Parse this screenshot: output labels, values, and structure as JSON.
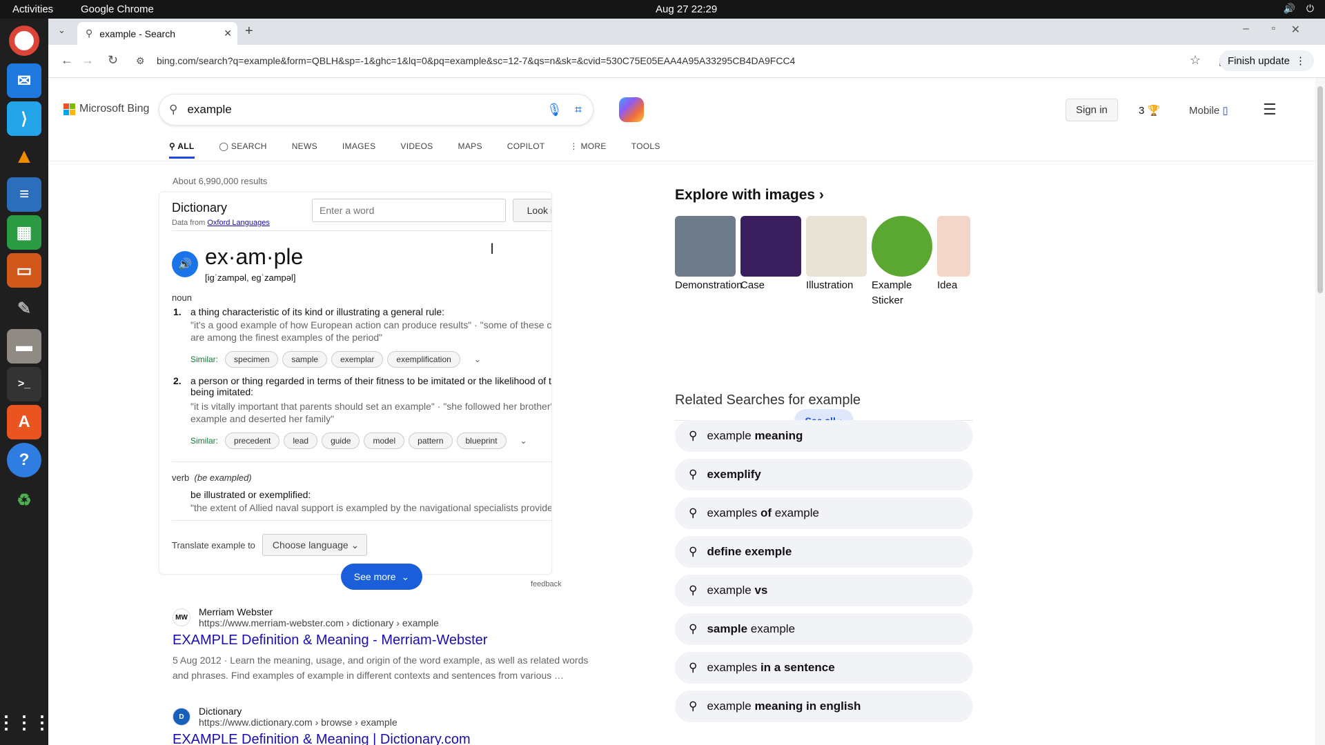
{
  "os": {
    "activities": "Activities",
    "app": "Google Chrome",
    "clock": "Aug 27  22:29"
  },
  "browser": {
    "tab_title": "example - Search",
    "url": "bing.com/search?q=example&form=QBLH&sp=-1&ghc=1&lq=0&pq=example&sc=12-7&qs=n&sk=&cvid=530C75E05EAA4A95A33295CB4DA9FCC4",
    "finish_update": "Finish update"
  },
  "bing": {
    "logo": "Microsoft Bing",
    "query": "example",
    "signin": "Sign in",
    "rewards": "3",
    "mobile": "Mobile",
    "tabs": [
      "ALL",
      "SEARCH",
      "NEWS",
      "IMAGES",
      "VIDEOS",
      "MAPS",
      "COPILOT",
      "MORE",
      "TOOLS"
    ],
    "result_count": "About 6,990,000 results"
  },
  "dictionary": {
    "title": "Dictionary",
    "source_prefix": "Data from",
    "source": "Oxford Languages",
    "input_placeholder": "Enter a word",
    "lookup": "Look it up",
    "word": "ex·am·ple",
    "pron": "[iɡˈzampəl, eɡˈzampəl]",
    "noun": "noun",
    "def1_num": "1.",
    "def1": "a thing characteristic of its kind or illustrating a general rule:",
    "def1_ex": "\"it's a good example of how European action can produce results\" · \"some of these carpets are among the finest examples of the period\"",
    "similar_label": "Similar:",
    "sim1": [
      "specimen",
      "sample",
      "exemplar",
      "exemplification"
    ],
    "def2_num": "2.",
    "def2": "a person or thing regarded in terms of their fitness to be imitated or the likelihood of their being imitated:",
    "def2_ex": "\"it is vitally important that parents should set an example\" · \"she followed her brother's example and deserted her family\"",
    "sim2": [
      "precedent",
      "lead",
      "guide",
      "model",
      "pattern",
      "blueprint"
    ],
    "verb": "verb",
    "verb_note": "(be exampled)",
    "def3": "be illustrated or exemplified:",
    "def3_ex": "\"the extent of Allied naval support is exampled by the navigational specialists provided\"",
    "translate": "Translate example to",
    "choose_lang": "Choose language",
    "see_more": "See more",
    "feedback": "feedback"
  },
  "results": [
    {
      "name": "Merriam Webster",
      "url": "https://www.merriam-webster.com › dictionary › example",
      "title": "EXAMPLE Definition & Meaning - Merriam-Webster",
      "snippet": "5 Aug 2012 · Learn the meaning, usage, and origin of the word example, as well as related words and phrases. Find examples of example in different contexts and sentences from various …"
    },
    {
      "name": "Dictionary",
      "url": "https://www.dictionary.com › browse › example",
      "title": "EXAMPLE Definition & Meaning | Dictionary.com"
    }
  ],
  "explore": {
    "title": "Explore with images ›",
    "items": [
      {
        "label": "Demonstration",
        "color": "#6d7b8a"
      },
      {
        "label": "Case",
        "color": "#3a1f5e"
      },
      {
        "label": "Illustration",
        "color": "#e9e3d6"
      },
      {
        "label": "Example Sticker",
        "color": "#5aa832"
      },
      {
        "label": "Idea",
        "color": "#f3d6c8"
      }
    ],
    "see_all": "See all"
  },
  "related": {
    "title": "Related Searches for example",
    "items": [
      {
        "pre": "example ",
        "bold": "meaning",
        "post": ""
      },
      {
        "pre": "",
        "bold": "exemplify",
        "post": ""
      },
      {
        "pre": "examples ",
        "bold": "of",
        "post": " example"
      },
      {
        "pre": "",
        "bold": "define exemple",
        "post": ""
      },
      {
        "pre": "example ",
        "bold": "vs",
        "post": ""
      },
      {
        "pre": "",
        "bold": "sample",
        "post": " example"
      },
      {
        "pre": "examples ",
        "bold": "in a sentence",
        "post": ""
      },
      {
        "pre": "example ",
        "bold": "meaning in english",
        "post": ""
      }
    ]
  }
}
